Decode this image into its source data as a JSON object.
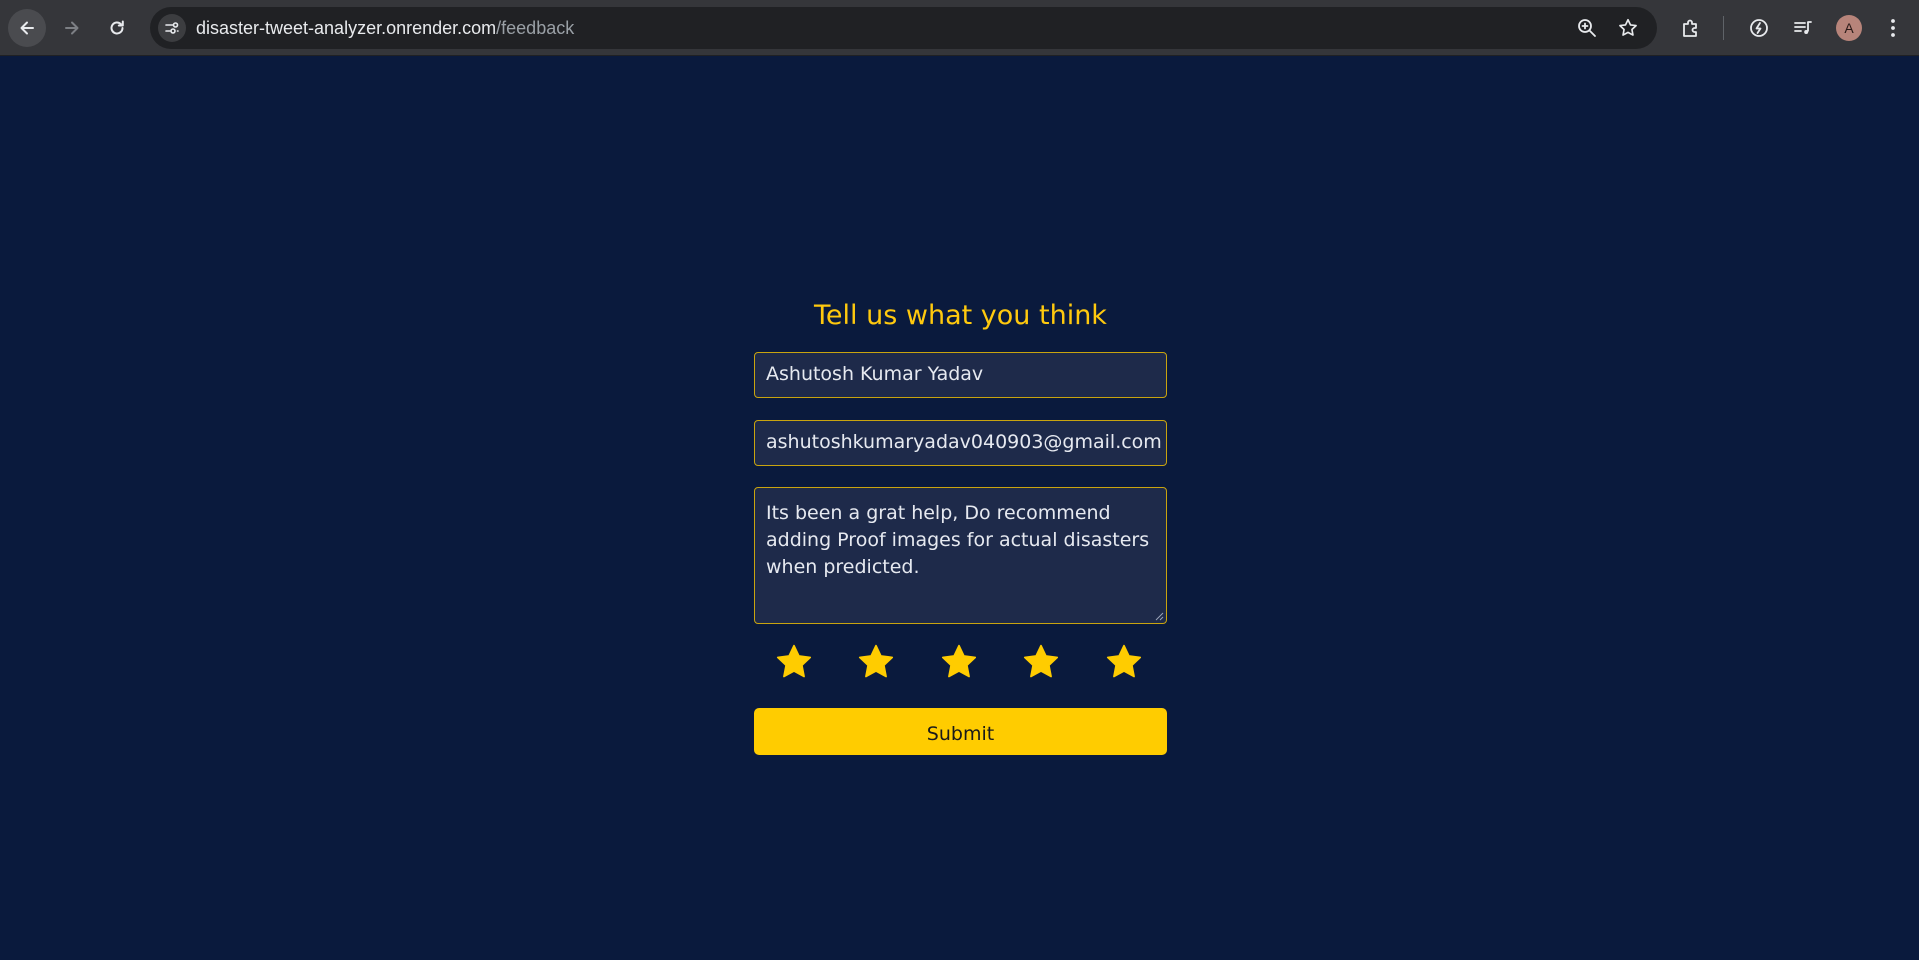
{
  "browser": {
    "url_host": "disaster-tweet-analyzer.onrender.com",
    "url_path": "/feedback",
    "profile_initial": "A"
  },
  "form": {
    "title": "Tell us what you think",
    "name_value": "Ashutosh Kumar Yadav",
    "email_value": "ashutoshkumaryadav040903@gmail.com",
    "message_value": "Its been a grat help, Do recommend adding Proof images for actual disasters when predicted.",
    "rating": {
      "selected": 5,
      "max": 5
    },
    "submit_label": "Submit"
  },
  "colors": {
    "background": "#0a1a3d",
    "accent": "#ffcc00",
    "field_background": "#1e2a4a",
    "field_border": "#c9a40f"
  }
}
